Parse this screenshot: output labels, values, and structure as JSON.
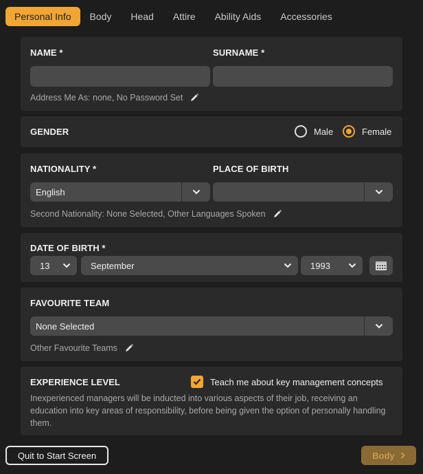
{
  "tabs": [
    {
      "label": "Personal Info",
      "active": true
    },
    {
      "label": "Body"
    },
    {
      "label": "Head"
    },
    {
      "label": "Attire"
    },
    {
      "label": "Ability Aids"
    },
    {
      "label": "Accessories"
    }
  ],
  "name_section": {
    "name_label": "NAME *",
    "name_value": "",
    "surname_label": "SURNAME *",
    "surname_value": "",
    "address_text": "Address Me As: none, No Password Set"
  },
  "gender": {
    "label": "GENDER",
    "options": [
      "Male",
      "Female"
    ],
    "selected": "Female"
  },
  "nationality": {
    "label": "NATIONALITY *",
    "value": "English",
    "place_of_birth_label": "PLACE OF BIRTH",
    "place_of_birth_value": "",
    "second_nationality_text": "Second Nationality: None Selected, Other Languages Spoken"
  },
  "date_of_birth": {
    "label": "DATE OF BIRTH *",
    "day": "13",
    "month": "September",
    "year": "1993"
  },
  "favourite_team": {
    "label": "FAVOURITE TEAM",
    "value": "None Selected",
    "other_text": "Other Favourite Teams"
  },
  "experience": {
    "label": "EXPERIENCE LEVEL",
    "checkbox_label": "Teach me about key management concepts",
    "checked": true,
    "description": "Inexperienced managers will be inducted into various aspects of their job, receiving an education into key areas of responsibility, before being given the option of personally handling them."
  },
  "footer": {
    "quit_label": "Quit to Start Screen",
    "next_label": "Body"
  },
  "colors": {
    "accent": "#f0a535",
    "panel": "#2a2a2a",
    "background": "#1d1d1d",
    "field": "#4a4a4a"
  }
}
